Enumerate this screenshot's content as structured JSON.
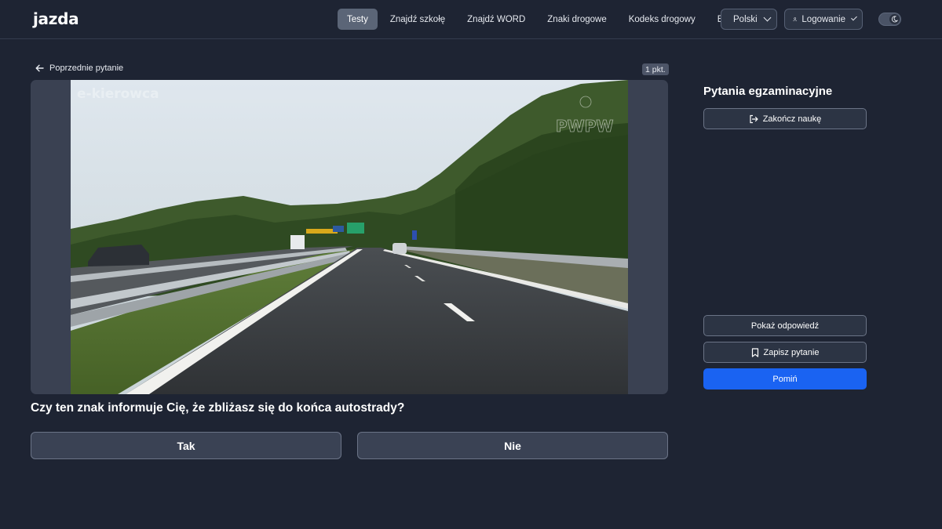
{
  "header": {
    "logo": "jazda",
    "nav": [
      "Testy",
      "Znajdź szkołę",
      "Znajdź WORD",
      "Znaki drogowe",
      "Kodeks drogowy",
      "Blog"
    ],
    "language": "Polski",
    "login": "Logowanie"
  },
  "main": {
    "prev_question": "Poprzednie pytanie",
    "points": "1 pkt.",
    "watermark_left": "e-kierowca",
    "watermark_right": "PWPW",
    "question": "Czy ten znak informuje Cię, że zbliżasz się do końca autostrady?",
    "answers": [
      "Tak",
      "Nie"
    ]
  },
  "sidebar": {
    "title": "Pytania egzaminacyjne",
    "finish": "Zakończ naukę",
    "show_answer": "Pokaż odpowiedź",
    "save_question": "Zapisz pytanie",
    "skip": "Pomiń"
  },
  "colors": {
    "background": "#1e2433",
    "primary": "#1a63f2",
    "active_nav": "#5b6577"
  },
  "icons": {
    "back": "arrow-left-icon",
    "logout": "logout-icon",
    "bookmark": "bookmark-icon",
    "user": "user-icon",
    "moon": "moon-icon",
    "chevron": "chevron-down-icon"
  }
}
